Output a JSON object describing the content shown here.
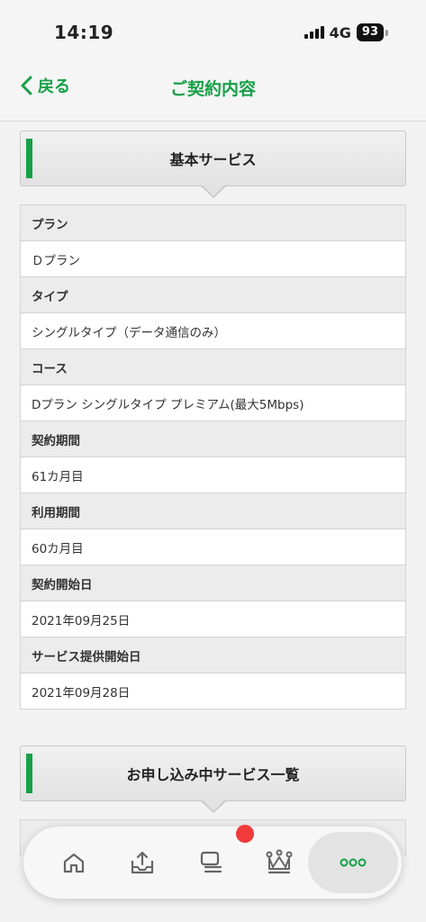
{
  "status_bar": {
    "time": "14:19",
    "network": "4G",
    "battery": "93"
  },
  "header": {
    "back_label": "戻る",
    "title": "ご契約内容"
  },
  "sections": [
    {
      "title": "基本サービス",
      "rows": [
        {
          "label": "プラン",
          "value": "Ｄプラン"
        },
        {
          "label": "タイプ",
          "value": "シングルタイプ（データ通信のみ）"
        },
        {
          "label": "コース",
          "value": "Dプラン シングルタイプ プレミアム(最大5Mbps)"
        },
        {
          "label": "契約期間",
          "value": "61カ月目"
        },
        {
          "label": "利用期間",
          "value": "60カ月目"
        },
        {
          "label": "契約開始日",
          "value": "2021年09月25日"
        },
        {
          "label": "サービス提供開始日",
          "value": "2021年09月28日"
        }
      ]
    },
    {
      "title": "お申し込み中サービス一覧"
    }
  ],
  "tabbar": {
    "tabs": [
      {
        "icon": "home-icon"
      },
      {
        "icon": "upload-tray-icon"
      },
      {
        "icon": "chat-icon",
        "badge": true
      },
      {
        "icon": "crown-icon"
      },
      {
        "icon": "more-dots-icon",
        "active": true
      }
    ]
  },
  "colors": {
    "accent": "#16a047",
    "badge": "#f23b3b"
  }
}
